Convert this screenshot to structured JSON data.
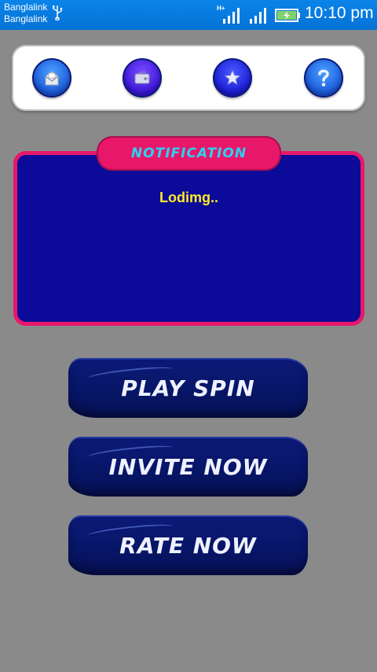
{
  "status_bar": {
    "carrier_1": "Banglalink",
    "carrier_2": "Banglalink",
    "network_type": "H+",
    "time": "10:10 pm"
  },
  "icon_panel": {
    "buttons": [
      {
        "icon": "mail-icon"
      },
      {
        "icon": "wallet-icon"
      },
      {
        "icon": "star-icon"
      },
      {
        "icon": "help-icon"
      }
    ]
  },
  "notification": {
    "title": "NOTIFICATION",
    "message": "Lodimg.."
  },
  "actions": {
    "play_label": "PLAY SPIN",
    "invite_label": "INVITE NOW",
    "rate_label": "RATE NOW"
  },
  "colors": {
    "background": "#8a8a8a",
    "status_bar": "#0572d6",
    "panel_fill": "#0c0a98",
    "panel_border": "#e8176a",
    "title_text": "#29d4f2",
    "message_text": "#ffe92a",
    "button_fill": "#071566"
  }
}
